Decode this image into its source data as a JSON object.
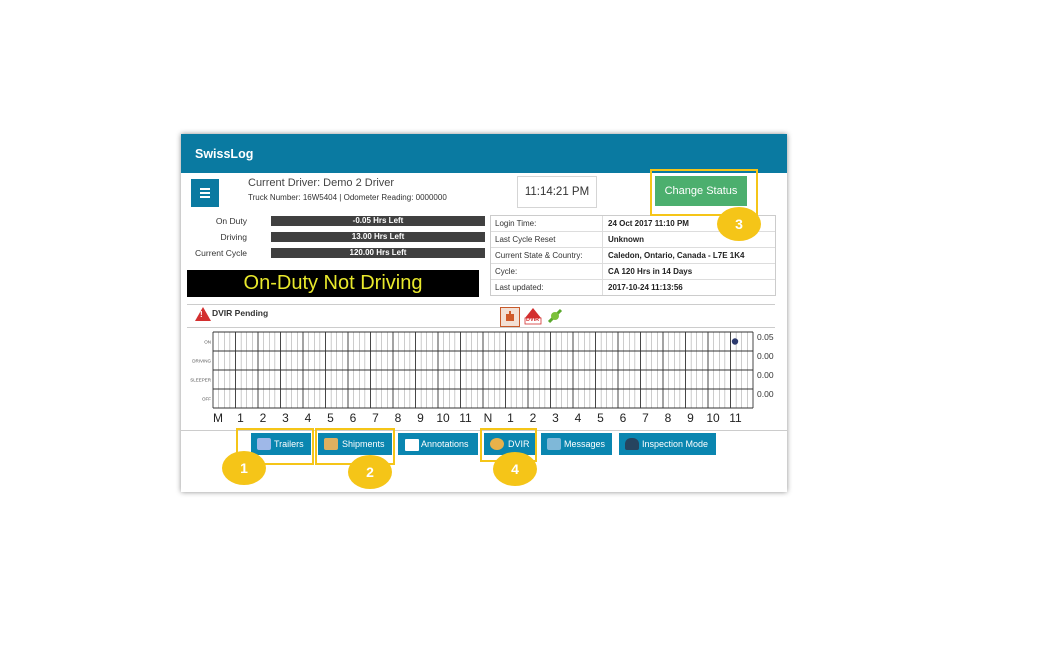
{
  "app": {
    "title": "SwissLog"
  },
  "header": {
    "driver_line": "Current Driver: Demo 2 Driver",
    "truck_line": "Truck Number: 16W5404 |  Odometer Reading: 0000000",
    "clock": "11:14:21 PM",
    "change_status_label": "Change Status"
  },
  "hours": [
    {
      "label": "On Duty",
      "value": "-0.05 Hrs Left"
    },
    {
      "label": "Driving",
      "value": "13.00 Hrs Left"
    },
    {
      "label": "Current Cycle",
      "value": "120.00 Hrs Left"
    }
  ],
  "current_status": "On-Duty Not Driving",
  "info": [
    {
      "key": "Login Time:",
      "value": "24 Oct 2017 11:10 PM"
    },
    {
      "key": "Last Cycle Reset",
      "value": "Unknown"
    },
    {
      "key": "Current State & Country:",
      "value": "Caledon, Ontario, Canada - L7E 1K4"
    },
    {
      "key": "Cycle:",
      "value": "CA 120 Hrs in 14 Days"
    },
    {
      "key": "Last updated:",
      "value": "2017-10-24 11:13:56"
    }
  ],
  "dvir_pending": "DVIR Pending",
  "dvir_badge": "DVIR",
  "graph": {
    "rows": [
      "ON",
      "DRIVING",
      "SLEEPER",
      "OFF"
    ],
    "totals": [
      "0.05",
      "0.00",
      "0.00",
      "0.00"
    ],
    "hours": [
      "M",
      "1",
      "2",
      "3",
      "4",
      "5",
      "6",
      "7",
      "8",
      "9",
      "10",
      "11",
      "N",
      "1",
      "2",
      "3",
      "4",
      "5",
      "6",
      "7",
      "8",
      "9",
      "10",
      "11"
    ],
    "current_point": {
      "status": "ON",
      "hour": 23.2
    }
  },
  "toolbar": {
    "buttons": [
      {
        "label": "Trailers",
        "icon": "trailer-icon"
      },
      {
        "label": "Shipments",
        "icon": "shipment-icon"
      },
      {
        "label": "Annotations",
        "icon": "annotation-icon"
      },
      {
        "label": "DVIR",
        "icon": "dvir-icon"
      },
      {
        "label": "Messages",
        "icon": "messages-icon"
      },
      {
        "label": "Inspection Mode",
        "icon": "inspector-icon"
      }
    ]
  },
  "callouts": [
    "1",
    "2",
    "3",
    "4"
  ],
  "colors": {
    "header": "#0a7aa1",
    "button": "#0a86b0",
    "change_status": "#4caf6e",
    "status_text": "#e8e82c",
    "highlight": "#f5c518"
  }
}
